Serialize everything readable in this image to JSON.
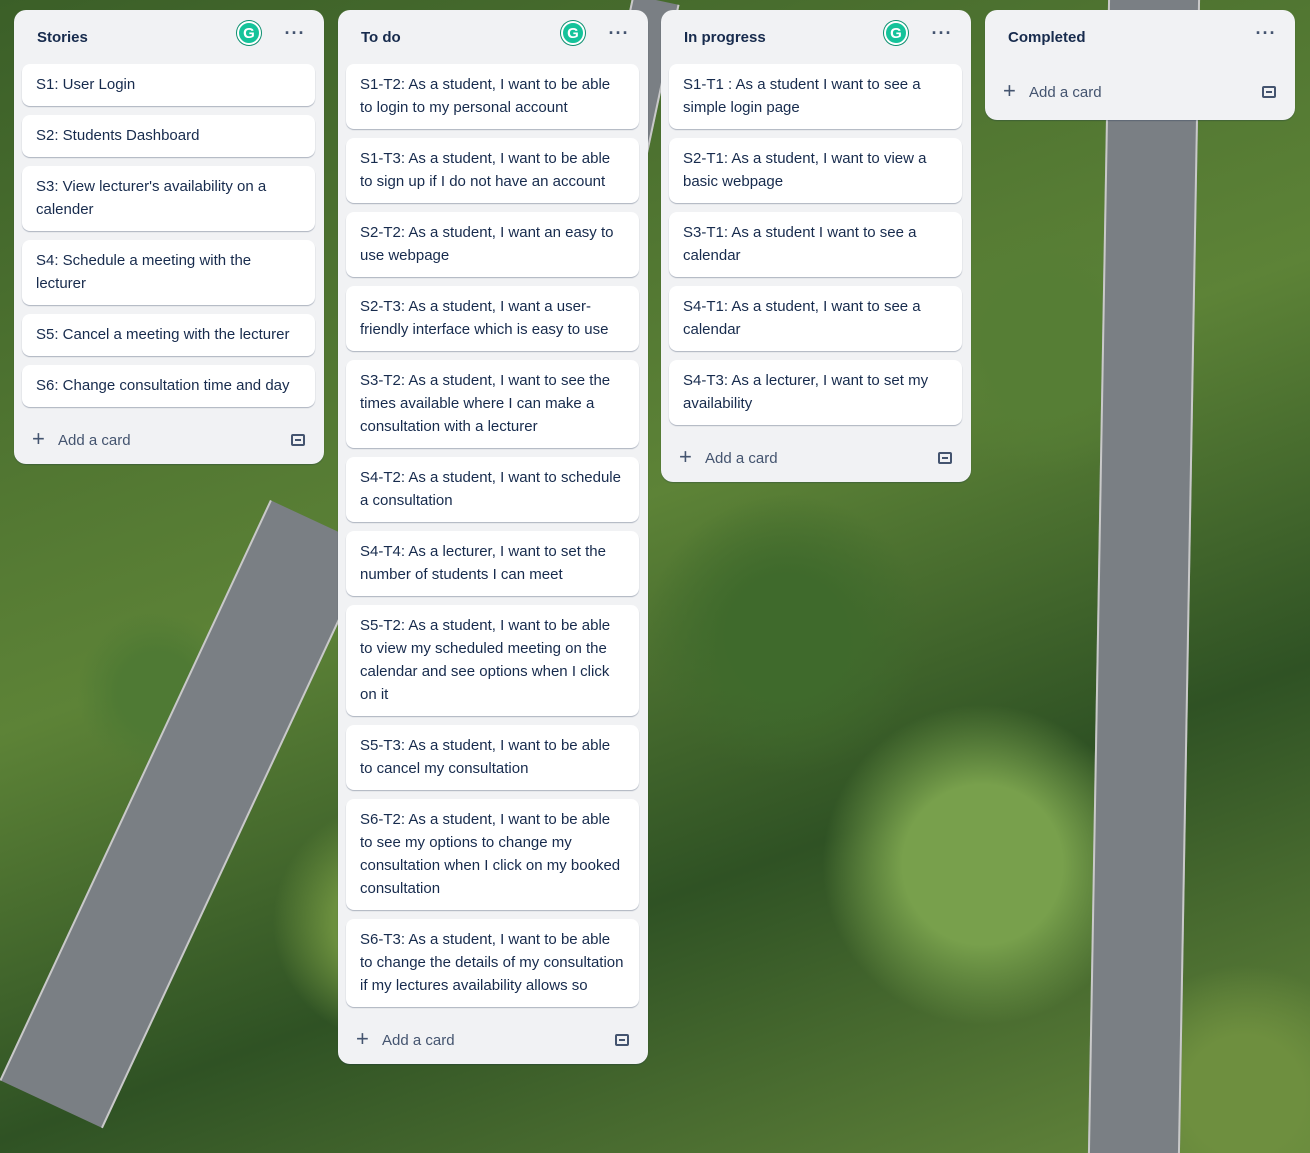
{
  "lists": [
    {
      "title": "Stories",
      "has_avatar": true,
      "cards": [
        "S1: User Login",
        "S2: Students Dashboard",
        "S3: View lecturer's availability on a calender",
        "S4: Schedule a meeting with the lecturer",
        "S5: Cancel a meeting with the lecturer",
        "S6: Change consultation time and day"
      ],
      "add_label": "Add a card"
    },
    {
      "title": "To do",
      "has_avatar": true,
      "cards": [
        "S1-T2: As a student, I want to be able to login to my personal account",
        "S1-T3: As a student, I want to be able to sign up if I do not have an account",
        "S2-T2: As a student, I want an easy to use webpage",
        "S2-T3: As a student, I want a user-friendly interface which is easy to use",
        "S3-T2: As a student, I want to see the times available where I can make a consultation with a lecturer",
        "S4-T2: As a student, I want to schedule a consultation",
        "S4-T4: As a lecturer, I want to set the number of students I can meet",
        "S5-T2: As a student, I want to be able to view my scheduled meeting on the calendar and see options when I click on it",
        "S5-T3: As a student, I want to be able to cancel my consultation",
        "S6-T2: As a student, I want to be able to see my options to change my consultation when I click on my booked consultation",
        "S6-T3: As a student, I want to be able to change the details of my consultation if my lectures availability allows so"
      ],
      "add_label": "Add a card"
    },
    {
      "title": "In progress",
      "has_avatar": true,
      "cards": [
        "S1-T1 : As a student I want to see a simple login page",
        "S2-T1: As a student, I want to view a basic webpage",
        "S3-T1: As a student I want to see a calendar",
        "S4-T1: As a student, I want to see a calendar",
        "S4-T3: As a lecturer, I want to set my availability"
      ],
      "add_label": "Add a card"
    },
    {
      "title": "Completed",
      "has_avatar": false,
      "cards": [],
      "add_label": "Add a card"
    }
  ],
  "avatar_letter": "G",
  "menu_glyph": "···",
  "plus_glyph": "+",
  "icons": {
    "avatar": "grammarly-avatar-icon",
    "menu": "more-horizontal-icon",
    "add": "plus-icon",
    "template": "card-template-icon"
  },
  "colors": {
    "list_bg": "#f1f2f4",
    "card_bg": "#ffffff",
    "text": "#172b4d",
    "avatar": "#15c39a"
  }
}
